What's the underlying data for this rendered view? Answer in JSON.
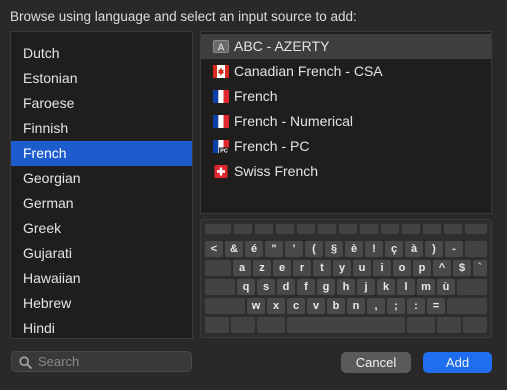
{
  "prompt": "Browse using language and select an input source to add:",
  "languages": [
    {
      "label": "Dutch"
    },
    {
      "label": "Estonian"
    },
    {
      "label": "Faroese"
    },
    {
      "label": "Finnish"
    },
    {
      "label": "French",
      "selected": true
    },
    {
      "label": "Georgian"
    },
    {
      "label": "German"
    },
    {
      "label": "Greek"
    },
    {
      "label": "Gujarati"
    },
    {
      "label": "Hawaiian"
    },
    {
      "label": "Hebrew"
    },
    {
      "label": "Hindi"
    }
  ],
  "sources": [
    {
      "label": "ABC - AZERTY",
      "icon": "letter-a-icon",
      "selected": true
    },
    {
      "label": "Canadian French - CSA",
      "icon": "canada-flag-icon"
    },
    {
      "label": "French",
      "icon": "france-flag-icon"
    },
    {
      "label": "French - Numerical",
      "icon": "france-flag-icon"
    },
    {
      "label": "French - PC",
      "icon": "france-flag-pc-icon"
    },
    {
      "label": "Swiss French",
      "icon": "swiss-flag-icon"
    }
  ],
  "keyboard": {
    "row1": [
      "<",
      "&",
      "é",
      "\"",
      "'",
      "(",
      "§",
      "è",
      "!",
      "ç",
      "à",
      ")",
      "-"
    ],
    "row2": [
      "a",
      "z",
      "e",
      "r",
      "t",
      "y",
      "u",
      "i",
      "o",
      "p",
      "^",
      "$",
      "`"
    ],
    "row3": [
      "q",
      "s",
      "d",
      "f",
      "g",
      "h",
      "j",
      "k",
      "l",
      "m",
      "ù"
    ],
    "row4": [
      "w",
      "x",
      "c",
      "v",
      "b",
      "n",
      ",",
      ";",
      ":",
      "="
    ]
  },
  "search": {
    "placeholder": "Search"
  },
  "buttons": {
    "cancel": "Cancel",
    "add": "Add"
  },
  "colors": {
    "selection": "#1d5ccd",
    "primary_button": "#1f6ef0"
  }
}
